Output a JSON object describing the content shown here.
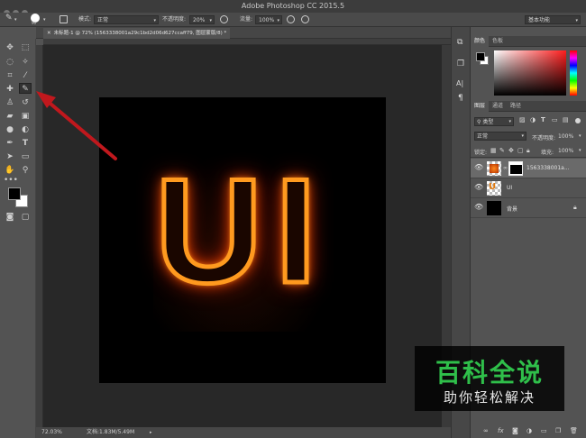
{
  "window": {
    "title": "Adobe Photoshop CC 2015.5"
  },
  "options": {
    "brush_size": "90",
    "mode_label": "模式:",
    "mode_value": "正常",
    "opacity_label": "不透明度:",
    "opacity_value": "20%",
    "flow_label": "流量:",
    "flow_value": "100%",
    "workspace": "基本功能"
  },
  "document": {
    "tab_label": "未标题-1 @ 72% (1563338001a29c1bd2d06d627ccaff79, 图层蒙版/8) *",
    "canvas_text": "UI",
    "zoom": "72.03%",
    "doc_info": "文档:1.83M/5.49M"
  },
  "color_panel": {
    "tabs": [
      "颜色",
      "色板"
    ],
    "foreground": "#000000",
    "background": "#ffffff",
    "hue_color": "#ff1d1d"
  },
  "layers_panel": {
    "tabs": [
      "图层",
      "通道",
      "路径"
    ],
    "filter_label": "类型",
    "blend_mode": "正常",
    "opacity_label": "不透明度:",
    "opacity_value": "100%",
    "lock_label": "锁定:",
    "fill_label": "填充:",
    "fill_value": "100%",
    "layers": [
      {
        "name": "1563338001a...",
        "selected": true
      },
      {
        "name": "UI",
        "selected": false
      },
      {
        "name": "背景",
        "selected": false
      }
    ]
  },
  "watermark": {
    "title": "百科全说",
    "subtitle": "助你轻松解决"
  }
}
